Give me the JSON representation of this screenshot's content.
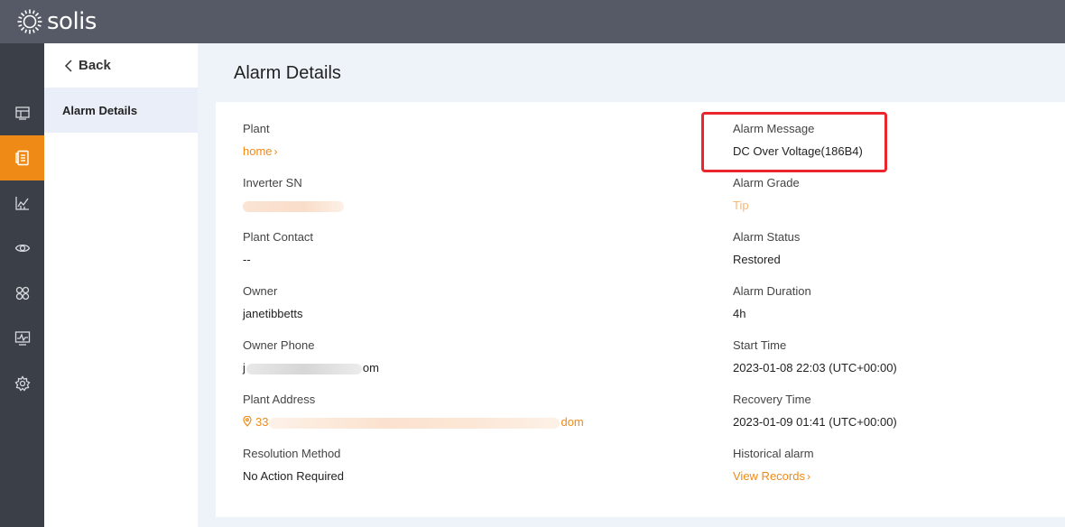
{
  "app": {
    "brand": "solis"
  },
  "nav": {
    "back_label": "Back",
    "current_item": "Alarm Details"
  },
  "page": {
    "title": "Alarm Details"
  },
  "left": {
    "plant_label": "Plant",
    "plant_value": "home",
    "inverter_sn_label": "Inverter SN",
    "inverter_sn_value": "...021B040224...",
    "plant_contact_label": "Plant Contact",
    "plant_contact_value": "--",
    "owner_label": "Owner",
    "owner_value": "janetibbetts",
    "owner_phone_label": "Owner Phone",
    "owner_phone_prefix": "j",
    "owner_phone_suffix": "om",
    "plant_address_label": "Plant Address",
    "plant_address_prefix": "33",
    "plant_address_suffix": "dom",
    "resolution_method_label": "Resolution Method",
    "resolution_method_value": "No Action Required"
  },
  "right": {
    "alarm_message_label": "Alarm Message",
    "alarm_message_value": "DC Over Voltage(186B4)",
    "alarm_grade_label": "Alarm Grade",
    "alarm_grade_value": "Tip",
    "alarm_status_label": "Alarm Status",
    "alarm_status_value": "Restored",
    "alarm_duration_label": "Alarm Duration",
    "alarm_duration_value": "4h",
    "start_time_label": "Start Time",
    "start_time_value": "2023-01-08 22:03 (UTC+00:00)",
    "recovery_time_label": "Recovery Time",
    "recovery_time_value": "2023-01-09 01:41 (UTC+00:00)",
    "historical_alarm_label": "Historical alarm",
    "historical_alarm_value": "View Records"
  },
  "colors": {
    "accent": "#ef8a17",
    "highlight": "#e8262c",
    "topbar": "#555a66",
    "rail": "#3b3f47"
  },
  "icons": {
    "rail": [
      "overview-icon",
      "alarm-icon",
      "chart-icon",
      "eye-icon",
      "services-icon",
      "monitor-icon",
      "settings-icon"
    ]
  }
}
